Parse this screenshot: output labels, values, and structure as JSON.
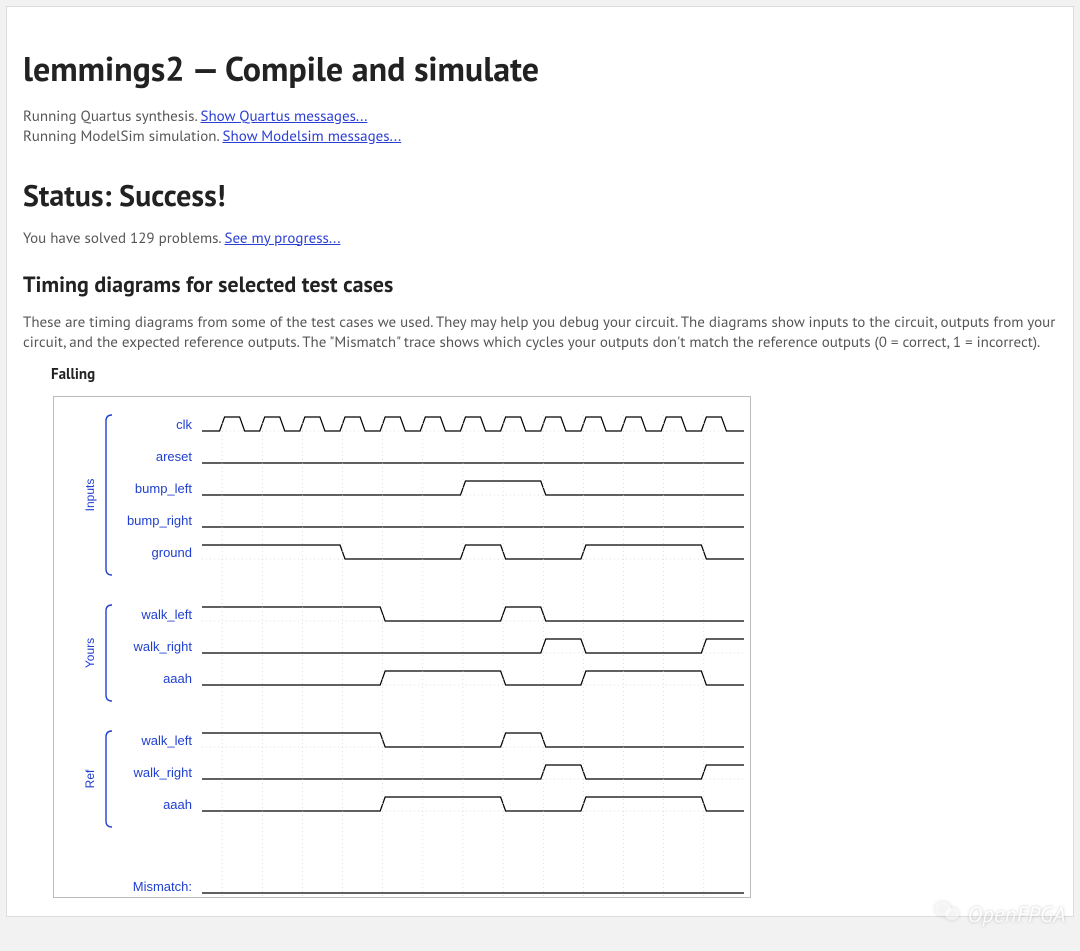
{
  "title": "lemmings2 — Compile and simulate",
  "synthesis": {
    "text": "Running Quartus synthesis. ",
    "link": "Show Quartus messages..."
  },
  "simulation": {
    "text": "Running ModelSim simulation. ",
    "link": "Show Modelsim messages..."
  },
  "status": "Status: Success!",
  "progress": {
    "text": "You have solved 129 problems. ",
    "link": "See my progress..."
  },
  "diagrams_heading": "Timing diagrams for selected test cases",
  "diagrams_intro": "These are timing diagrams from some of the test cases we used. They may help you debug your circuit. The diagrams show inputs to the circuit, outputs from your circuit, and the expected reference outputs. The \"Mismatch\" trace shows which cycles your outputs don't match the reference outputs (0 = correct, 1 = incorrect).",
  "testcase_name": "Falling",
  "groups": {
    "inputs": "Inputs",
    "yours": "Yours",
    "ref": "Ref"
  },
  "signals": {
    "clk": "clk",
    "areset": "areset",
    "bump_left": "bump_left",
    "bump_right": "bump_right",
    "ground": "ground",
    "walk_left": "walk_left",
    "walk_right": "walk_right",
    "aaah": "aaah",
    "mismatch": "Mismatch:"
  },
  "ticks": [
    "70",
    "80",
    "90",
    "100",
    "110",
    "120",
    "130",
    "140",
    "150",
    "160",
    "170",
    "180",
    "190"
  ],
  "watermark": "OpenFPGA",
  "chart_data": {
    "type": "timing-traces",
    "time": {
      "start": 65,
      "end": 200,
      "ticks": [
        70,
        80,
        90,
        100,
        110,
        120,
        130,
        140,
        150,
        160,
        170,
        180,
        190
      ],
      "clock_period": 10
    },
    "groups": [
      {
        "name": "Inputs",
        "signals": [
          "clk",
          "areset",
          "bump_left",
          "bump_right",
          "ground"
        ]
      },
      {
        "name": "Yours",
        "signals": [
          "walk_left",
          "walk_right",
          "aaah"
        ]
      },
      {
        "name": "Ref",
        "signals": [
          "walk_left",
          "walk_right",
          "aaah"
        ]
      },
      {
        "name": "",
        "signals": [
          "Mismatch"
        ]
      }
    ],
    "traces": {
      "clk": {
        "start": 0,
        "edges": [
          65,
          70,
          75,
          80,
          85,
          90,
          95,
          100,
          105,
          110,
          115,
          120,
          125,
          130,
          135,
          140,
          145,
          150,
          155,
          160,
          165,
          170,
          175,
          180,
          185,
          190,
          195,
          200
        ]
      },
      "areset": {
        "start": 0,
        "edges": []
      },
      "bump_left": {
        "start": 0,
        "edges": [
          130,
          150
        ]
      },
      "bump_right": {
        "start": 0,
        "edges": []
      },
      "ground": {
        "start": 1,
        "edges": [
          100,
          130,
          140,
          160,
          190
        ]
      },
      "yours.walk_left": {
        "start": 1,
        "edges": [
          110,
          140,
          150
        ]
      },
      "yours.walk_right": {
        "start": 0,
        "edges": [
          150,
          160,
          190
        ]
      },
      "yours.aaah": {
        "start": 0,
        "edges": [
          110,
          140,
          160,
          190
        ]
      },
      "ref.walk_left": {
        "start": 1,
        "edges": [
          110,
          140,
          150
        ]
      },
      "ref.walk_right": {
        "start": 0,
        "edges": [
          150,
          160,
          190
        ]
      },
      "ref.aaah": {
        "start": 0,
        "edges": [
          110,
          140,
          160,
          190
        ]
      },
      "Mismatch": {
        "start": 0,
        "edges": []
      }
    }
  }
}
